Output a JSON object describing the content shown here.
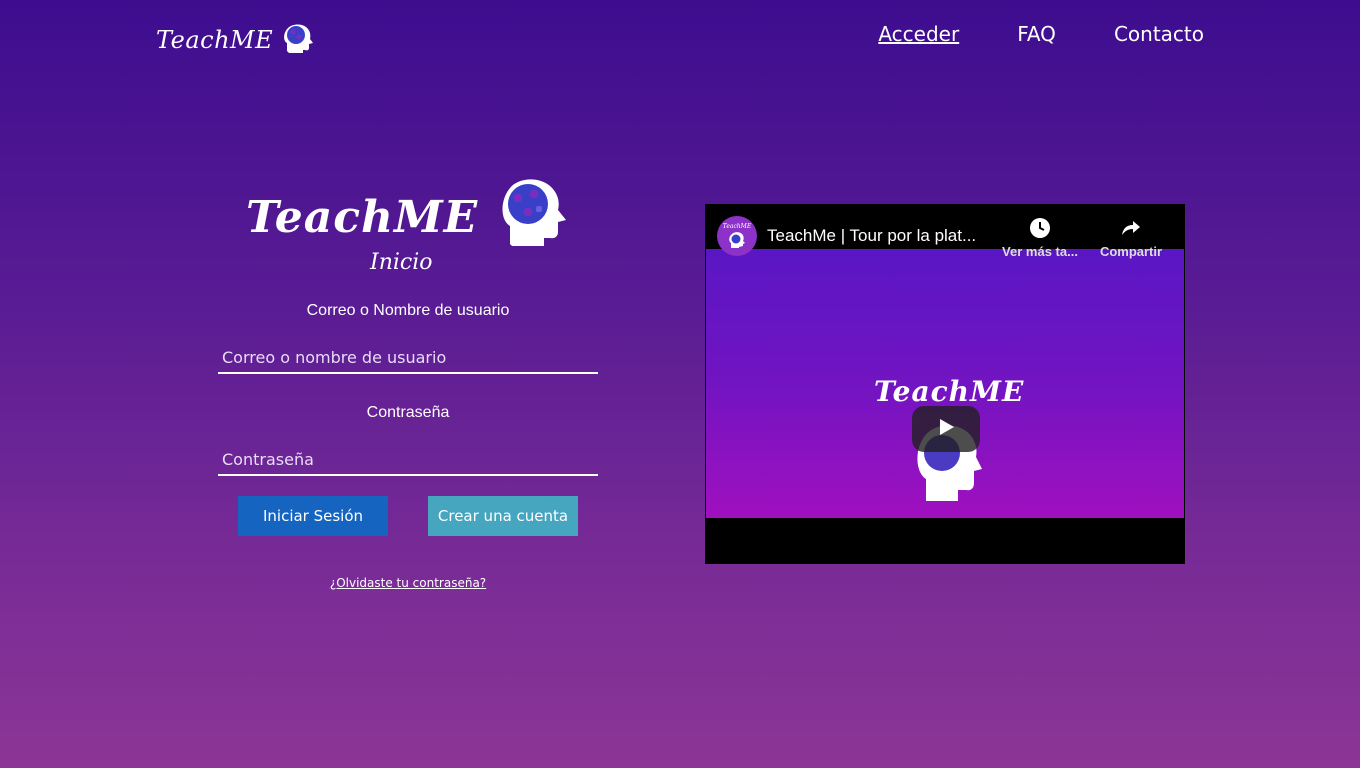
{
  "header": {
    "logo_text": "TeachME",
    "nav": [
      {
        "label": "Acceder",
        "active": true
      },
      {
        "label": "FAQ",
        "active": false
      },
      {
        "label": "Contacto",
        "active": false
      }
    ]
  },
  "login": {
    "logo_text": "TeachME",
    "subtitle": "Inicio",
    "user_label": "Correo o Nombre de usuario",
    "user_placeholder": "Correo o nombre de usuario",
    "password_label": "Contraseña",
    "password_placeholder": "Contraseña",
    "login_button": "Iniciar Sesión",
    "signup_button": "Crear una cuenta",
    "forgot_link": "¿Olvidaste tu contraseña?"
  },
  "video": {
    "channel_text": "TeachME",
    "title": "TeachMe | Tour por la plat...",
    "watch_later": "Ver más ta...",
    "share": "Compartir",
    "thumbnail_text": "TeachME"
  },
  "colors": {
    "primary_button": "#1565c0",
    "secondary_button": "#46a5bf",
    "background_top": "#3d0d8f",
    "background_bottom": "#8c3596"
  },
  "icons": [
    "brain-head-logo-icon",
    "clock-icon",
    "share-icon",
    "play-icon"
  ]
}
